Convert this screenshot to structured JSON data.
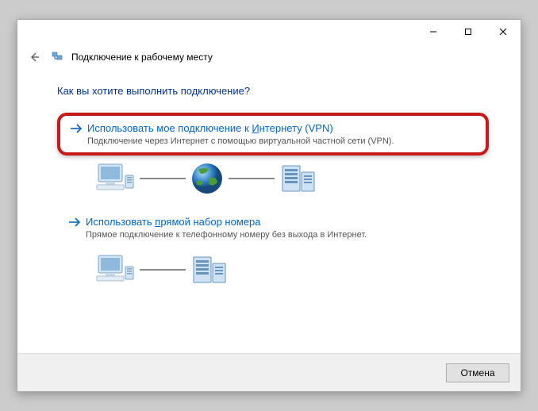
{
  "titlebar": {
    "minimize": "—",
    "maximize": "☐",
    "close": "✕"
  },
  "header": {
    "title": "Подключение к рабочему месту"
  },
  "content": {
    "heading": "Как вы хотите выполнить подключение?",
    "opt1": {
      "prefix": "Использовать мое подключение к ",
      "ul": "И",
      "suffix": "нтернету (VPN)",
      "desc": "Подключение через Интернет с помощью виртуальной частной сети (VPN)."
    },
    "opt2": {
      "prefix": "Использовать ",
      "ul": "п",
      "suffix": "рямой набор номера",
      "desc": "Прямое подключение к телефонному номеру без выхода в Интернет."
    }
  },
  "footer": {
    "cancel": "Отмена"
  }
}
